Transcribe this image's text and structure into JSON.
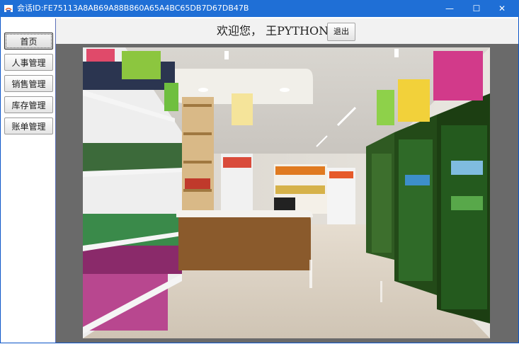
{
  "window": {
    "title": "会话ID:FE75113A8AB69A88B860A65A4BC65DB7D67DB47B",
    "controls": {
      "minimize": "—",
      "maximize": "☐",
      "close": "✕"
    }
  },
  "sidebar": {
    "items": [
      {
        "label": "首页",
        "active": true
      },
      {
        "label": "人事管理",
        "active": false
      },
      {
        "label": "销售管理",
        "active": false
      },
      {
        "label": "库存管理",
        "active": false
      },
      {
        "label": "账单管理",
        "active": false
      }
    ]
  },
  "header": {
    "welcome": "欢迎您， 王PYTHON",
    "logout_label": "退出"
  },
  "colors": {
    "titlebar": "#1f6fd6",
    "frame_border": "#0d56c9",
    "panel_background": "#6a6a6a"
  }
}
